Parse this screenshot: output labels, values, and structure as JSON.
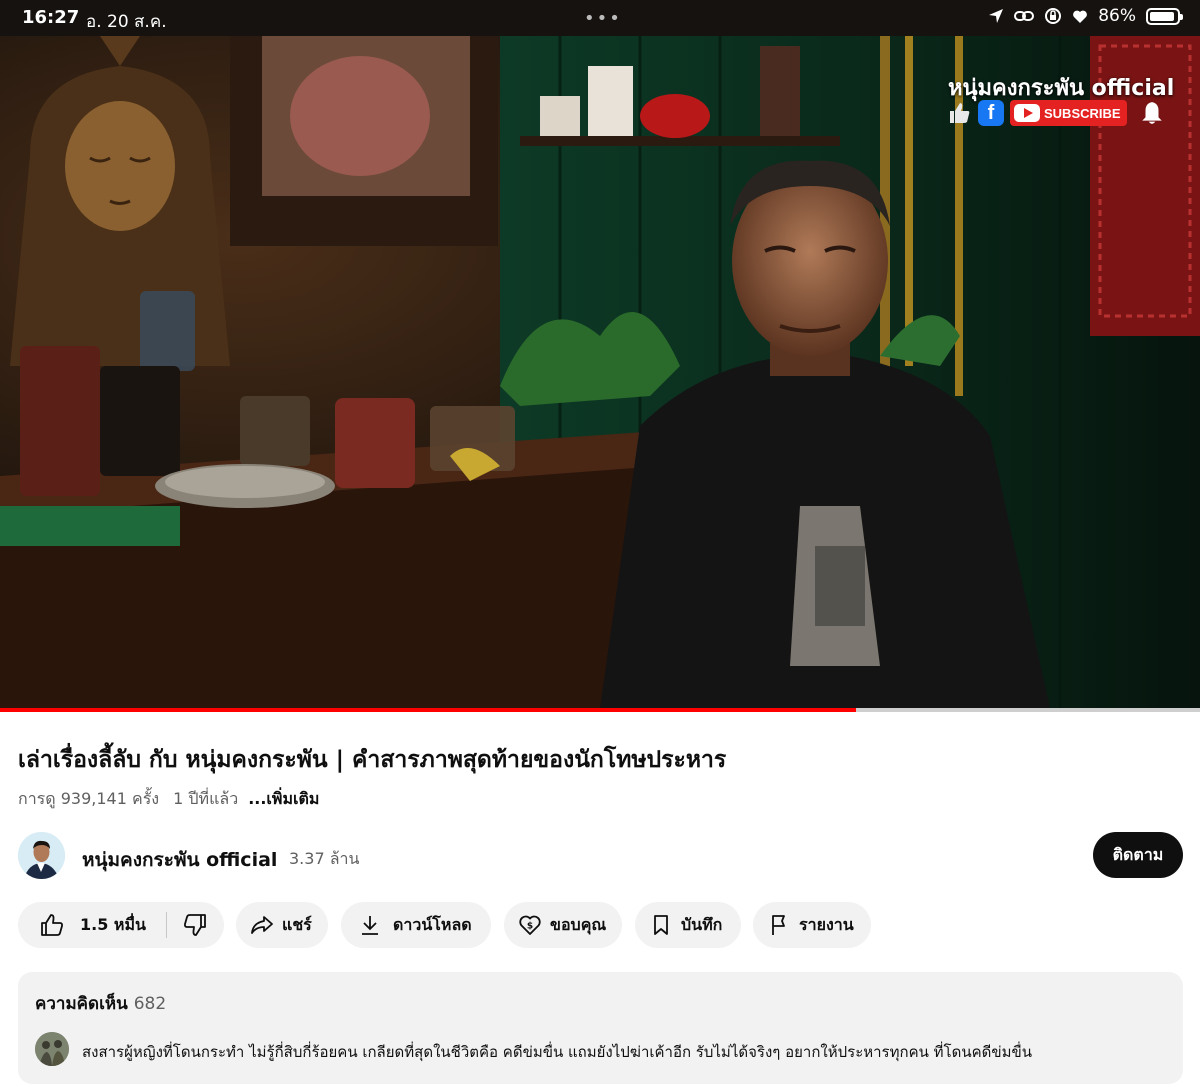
{
  "status_bar": {
    "time": "16:27",
    "date": "อ. 20 ส.ค.",
    "dots": "•••",
    "battery_pct": "86%"
  },
  "video": {
    "overlay_channel": "หนุ่มคงกระพัน official",
    "overlay_subscribe": "SUBSCRIBE",
    "overlay_fb": "f",
    "progress": 0.713
  },
  "title": "เล่าเรื่องลี้ลับ กับ หนุ่มคงกระพัน | คำสารภาพสุดท้ายของนักโทษประหาร",
  "meta": {
    "views": "การดู 939,141 ครั้ง",
    "age": "1 ปีที่แล้ว",
    "more": "...เพิ่มเติม"
  },
  "channel": {
    "name": "หนุ่มคงกระพัน official",
    "subscribers": "3.37 ล้าน",
    "follow_label": "ติดตาม"
  },
  "actions": {
    "likes": "1.5 หมื่น",
    "share": "แชร์",
    "download": "ดาวน์โหลด",
    "thanks": "ขอบคุณ",
    "save": "บันทึก",
    "report": "รายงาน"
  },
  "comments": {
    "header": "ความคิดเห็น",
    "count": "682",
    "top_comment": "สงสารผู้หญิงที่โดนกระทำ ไม่รู้กี่สิบกี่ร้อยคน เกลียดที่สุดในชีวิตคือ คดีข่มขื่น แถมยังไปฆ่าเค้าอีก รับไม่ได้จริงๆ อยากให้ประหารทุกคน ที่โดนคดีข่มขื่น"
  },
  "colors": {
    "accent_red": "#ff0000",
    "pill_bg": "#f2f2f2",
    "secondary_text": "#606060"
  }
}
